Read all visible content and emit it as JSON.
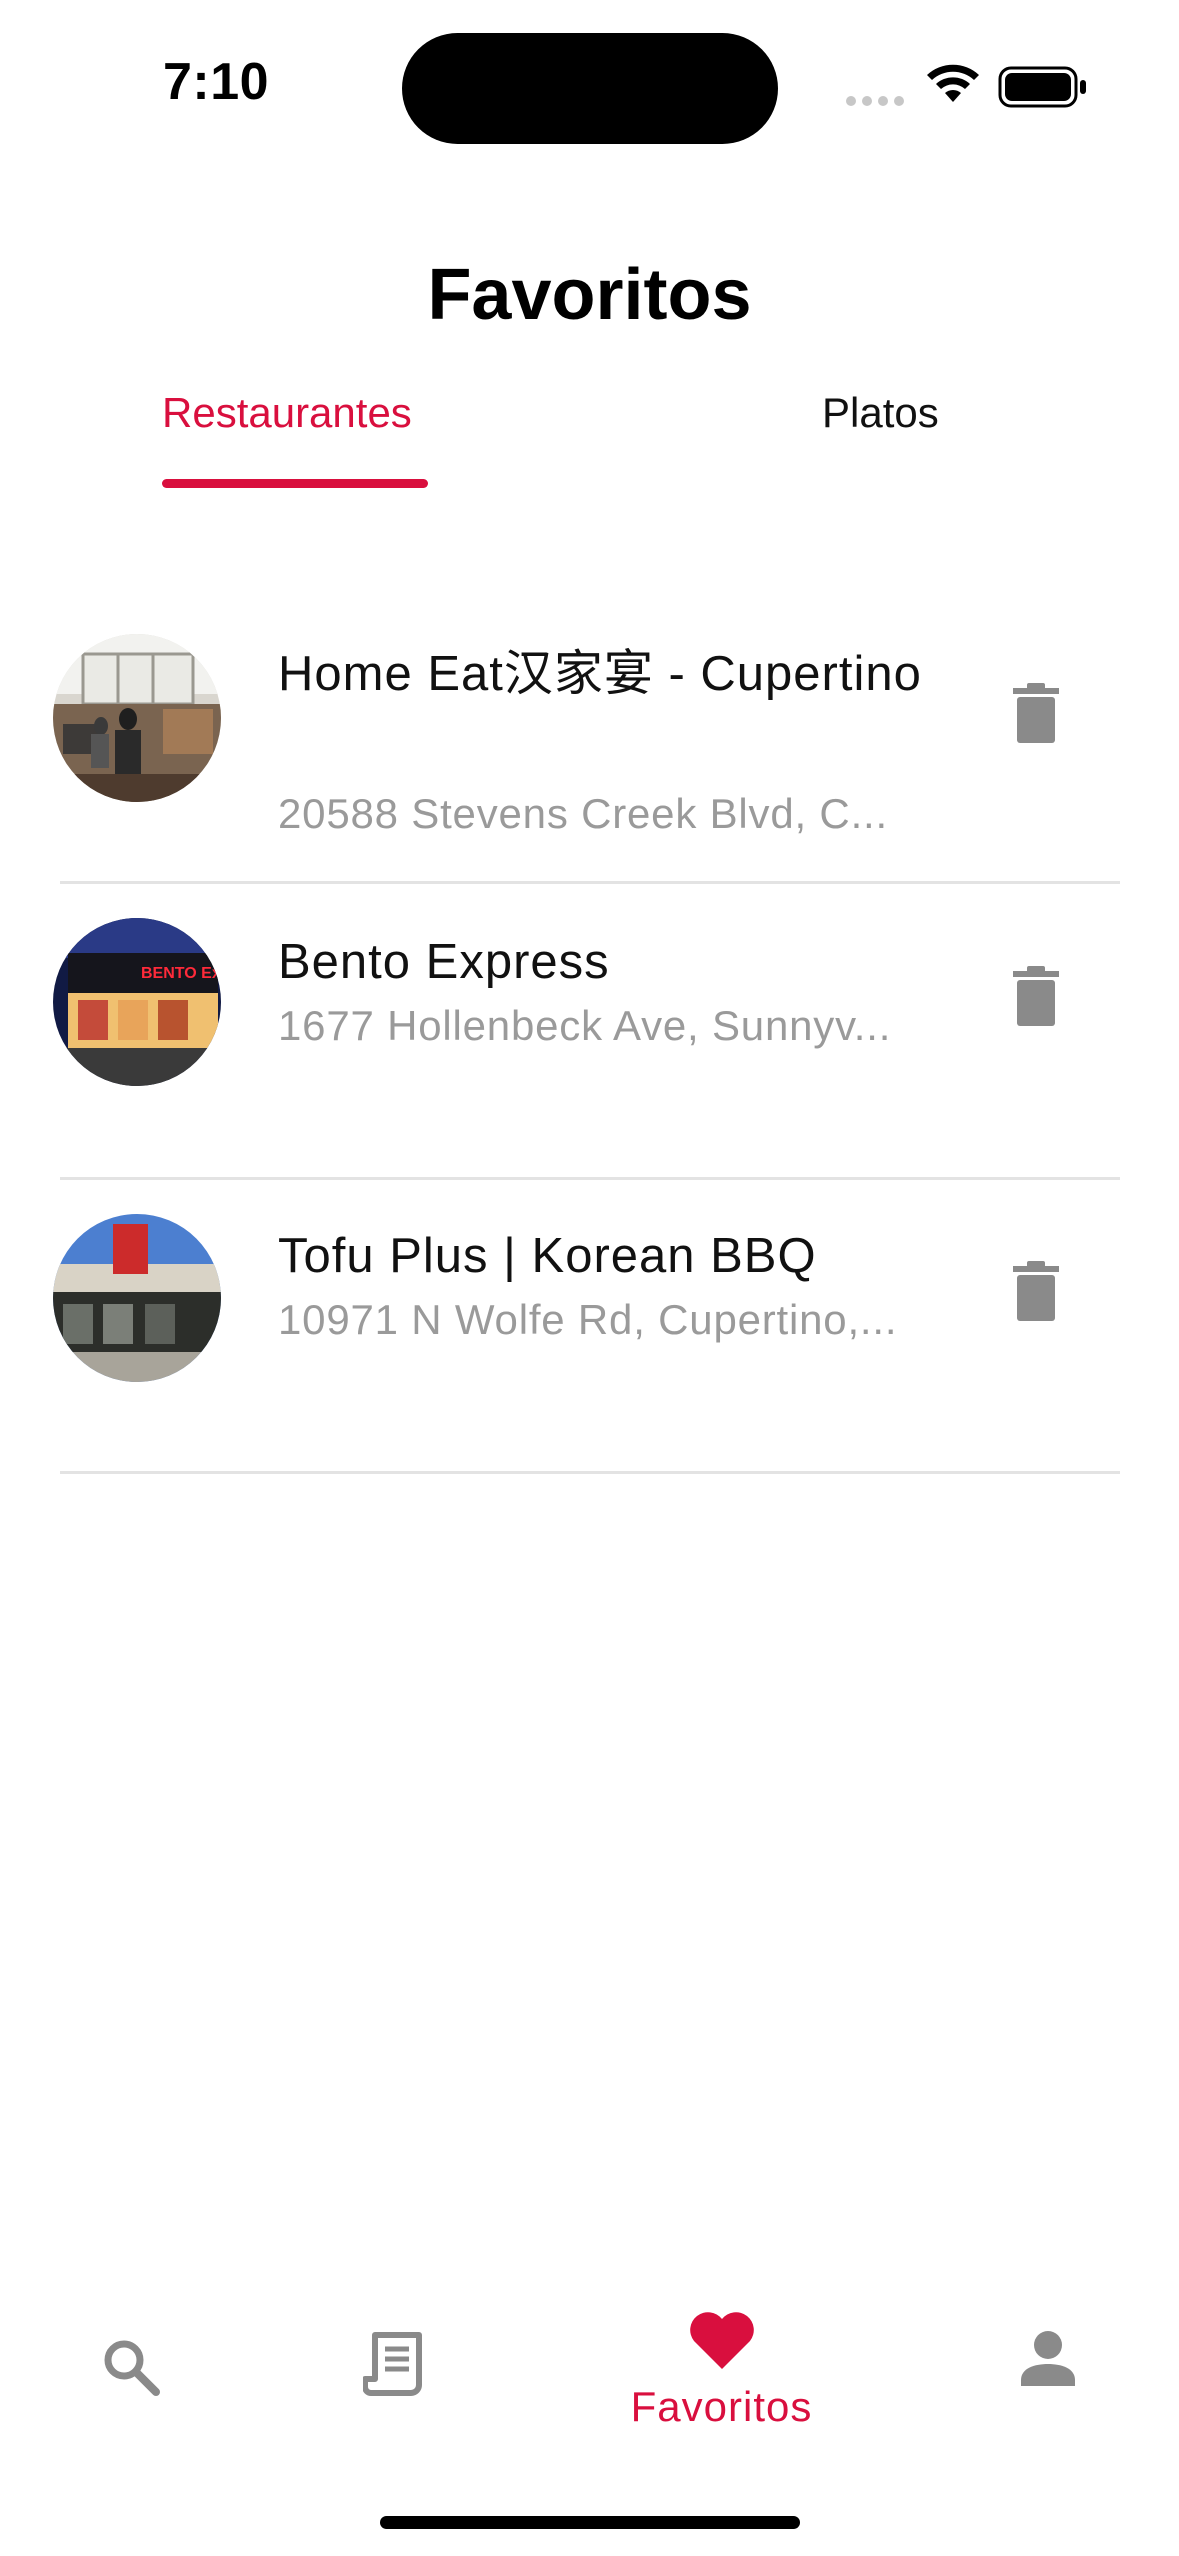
{
  "status_bar": {
    "time": "7:10"
  },
  "header": {
    "title": "Favoritos"
  },
  "tabs": [
    {
      "label": "Restaurantes",
      "active": true
    },
    {
      "label": "Platos",
      "active": false
    }
  ],
  "favorites": [
    {
      "name": "Home Eat汉家宴 - Cupertino",
      "address": "20588 Stevens Creek Blvd, C..."
    },
    {
      "name": "Bento Express",
      "address": "1677 Hollenbeck Ave, Sunnyv..."
    },
    {
      "name": "Tofu Plus | Korean BBQ",
      "address": "10971 N Wolfe Rd, Cupertino,..."
    }
  ],
  "tab_bar": {
    "items": [
      {
        "icon": "search-icon",
        "label": ""
      },
      {
        "icon": "receipt-icon",
        "label": ""
      },
      {
        "icon": "heart-icon",
        "label": "Favoritos",
        "active": true
      },
      {
        "icon": "person-icon",
        "label": ""
      }
    ]
  },
  "colors": {
    "accent": "#d90f3e",
    "muted": "#9a9a9a",
    "icon": "#8a8a8a"
  }
}
